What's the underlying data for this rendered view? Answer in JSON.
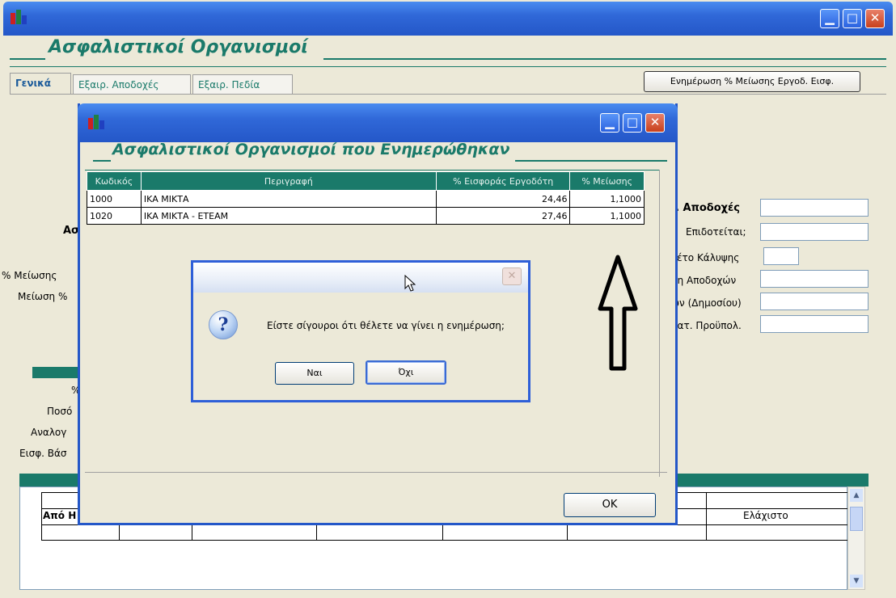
{
  "main": {
    "title": "Ασφαλιστικοί Οργανισμοί",
    "tabs": [
      {
        "label": "Γενικά"
      },
      {
        "label": "Εξαιρ. Αποδοχές"
      },
      {
        "label": "Εξαιρ. Πεδία"
      }
    ],
    "update_button": "Ενημέρωση % Μείωσης Εργοδ. Εισφ.",
    "left_labels": [
      "Ασ",
      "% Μείωσης",
      "Μείωση %",
      "%",
      "Ποσό",
      "Αναλογ",
      "Εισφ. Βάσ"
    ],
    "right_labels": [
      "ι. Αποδοχές",
      "Επιδοτείται;",
      "κέτο Κάλυψης",
      "ση Αποδοχών",
      "ών (Δημοσίου)",
      "ρατ. Προϋπολ."
    ],
    "bottom_table": {
      "col_left": "Από Η",
      "col_right": "Ελάχιστο"
    }
  },
  "modal1": {
    "title": "Ασφαλιστικοί Οργανισμοί που Ενημερώθηκαν",
    "columns": [
      "Κωδικός",
      "Περιγραφή",
      "% Εισφοράς Εργοδότη",
      "% Μείωσης"
    ],
    "rows": [
      {
        "code": "1000",
        "desc": "ΙΚΑ ΜΙΚΤΑ",
        "rate": "24,46",
        "reduction": "1,1000"
      },
      {
        "code": "1020",
        "desc": "ΙΚΑ ΜΙΚΤΑ - ΕΤΕΑΜ",
        "rate": "27,46",
        "reduction": "1,1000"
      }
    ],
    "ok_label": "ΟΚ"
  },
  "dialog": {
    "question_mark": "?",
    "message": "Είστε σίγουροι ότι θέλετε να γίνει η ενημέρωση;",
    "yes_label": "Ναι",
    "no_label": "Όχι"
  },
  "icons": {
    "close_glyph": "✕",
    "minimize_glyph": "▁",
    "maximize_glyph": "□",
    "scroll_up_glyph": "▲",
    "scroll_down_glyph": "▼"
  },
  "colors": {
    "teal": "#1a7a6a",
    "xp_blue": "#2457c8",
    "close_red": "#c8401c"
  }
}
